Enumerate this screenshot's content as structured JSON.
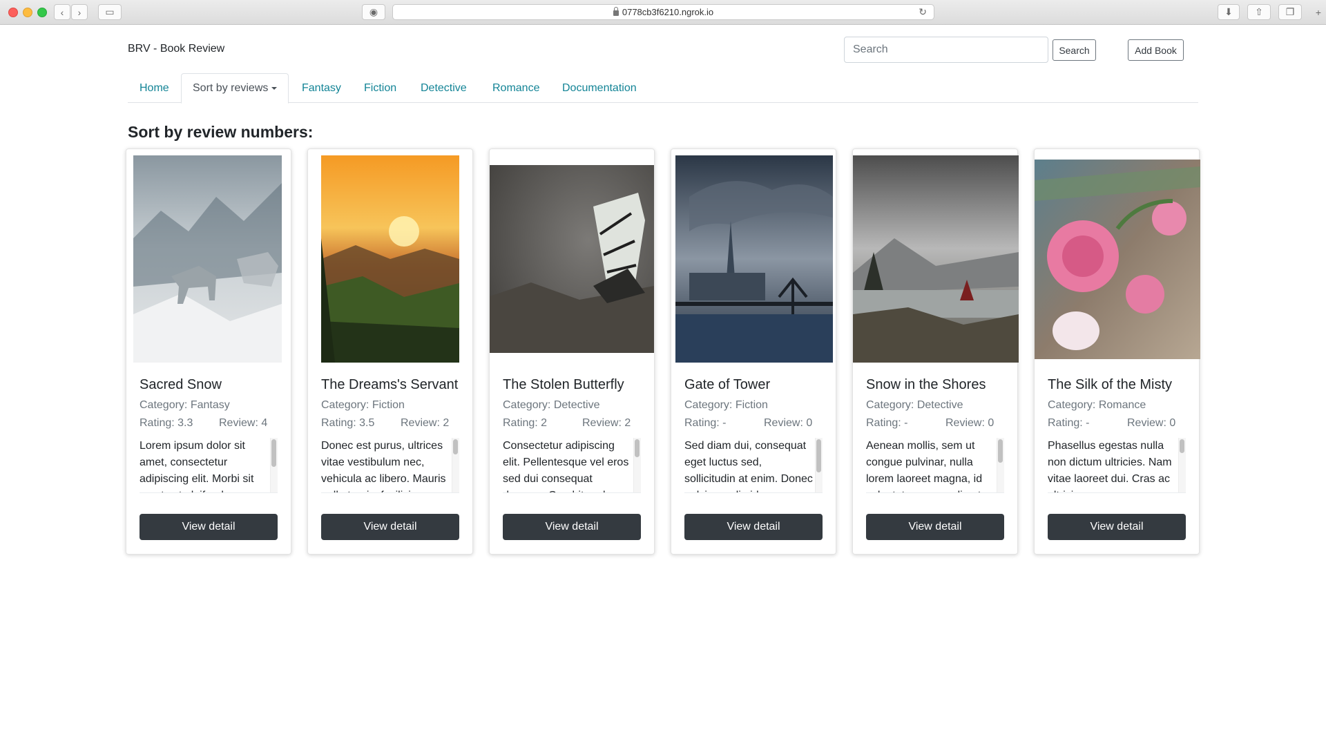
{
  "browser": {
    "url": "0778cb3f6210.ngrok.io"
  },
  "header": {
    "brand": "BRV - Book Review",
    "search_placeholder": "Search",
    "search_button": "Search",
    "add_book_button": "Add Book"
  },
  "nav": {
    "tabs": [
      {
        "label": "Home"
      },
      {
        "label": "Sort by reviews"
      },
      {
        "label": "Fantasy"
      },
      {
        "label": "Fiction"
      },
      {
        "label": "Detective"
      },
      {
        "label": "Romance"
      },
      {
        "label": "Documentation"
      }
    ]
  },
  "main": {
    "heading": "Sort by review numbers:",
    "books": [
      {
        "title": "Sacred Snow",
        "category": "Category: Fantasy",
        "rating": "Rating: 3.3",
        "review": "Review: 4",
        "description": "Lorem ipsum dolor sit amet, consectetur adipiscing elit. Morbi sit amet est eleifend",
        "button": "View detail"
      },
      {
        "title": "The Dreams's Servant",
        "category": "Category: Fiction",
        "rating": "Rating: 3.5",
        "review": "Review: 2",
        "description": "Donec est purus, ultrices vitae vestibulum nec, vehicula ac libero. Mauris nulla turpis, facilisis",
        "button": "View detail"
      },
      {
        "title": "The Stolen Butterfly",
        "category": "Category: Detective",
        "rating": "Rating: 2",
        "review": "Review: 2",
        "description": "Consectetur adipiscing elit. Pellentesque vel eros sed dui consequat rhoncus. Curabitur ele",
        "button": "View detail"
      },
      {
        "title": "Gate of Tower",
        "category": "Category: Fiction",
        "rating": "Rating: -",
        "review": "Review: 0",
        "description": "Sed diam dui, consequat eget luctus sed, sollicitudin at enim. Donec pulvinar odio id",
        "button": "View detail"
      },
      {
        "title": "Snow in the Shores",
        "category": "Category: Detective",
        "rating": "Rating: -",
        "review": "Review: 0",
        "description": "Aenean mollis, sem ut congue pulvinar, nulla lorem laoreet magna, id vulputate augue odio at",
        "button": "View detail"
      },
      {
        "title": "The Silk of the Misty",
        "category": "Category: Romance",
        "rating": "Rating: -",
        "review": "Review: 0",
        "description": "Phasellus egestas nulla non dictum ultricies. Nam vitae laoreet dui. Cras ac ultricies nunc",
        "button": "View detail"
      }
    ]
  }
}
